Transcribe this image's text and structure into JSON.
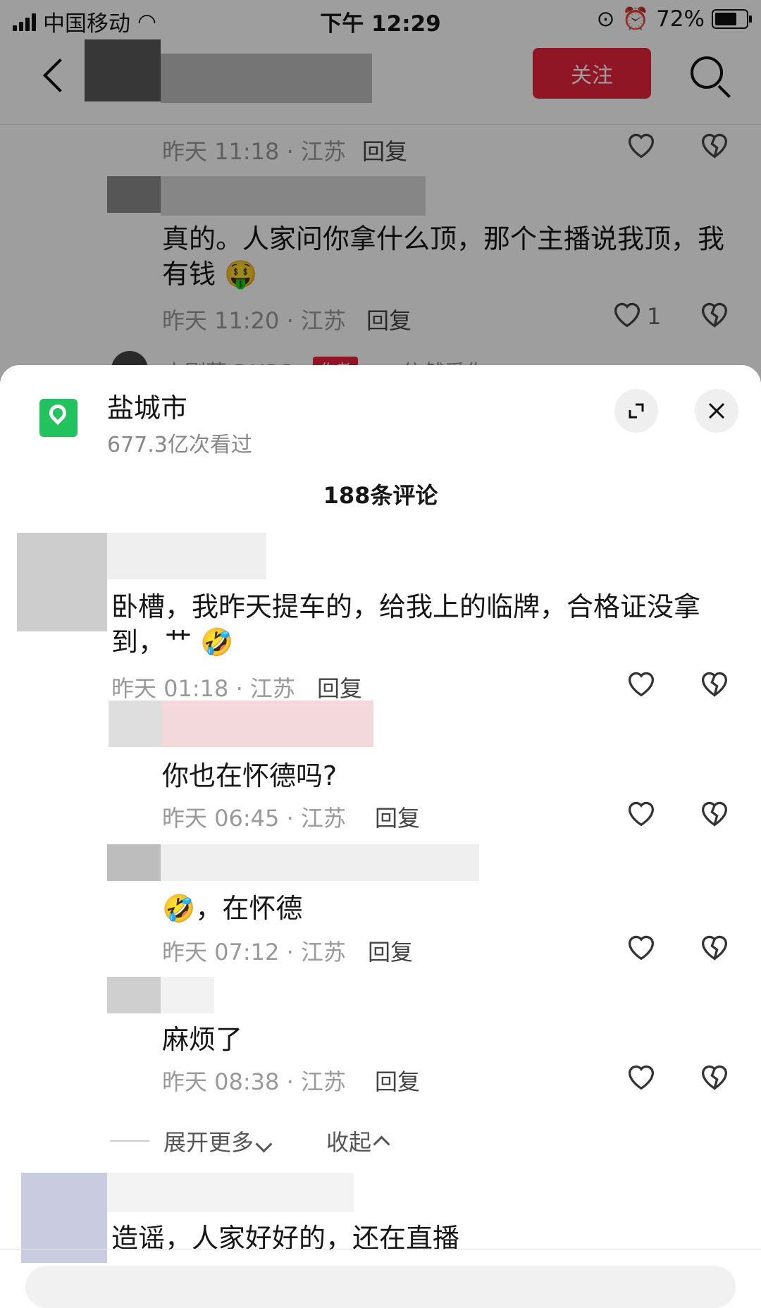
{
  "status": {
    "carrier": "中国移动",
    "time": "下午 12:29",
    "battery": "72%"
  },
  "header": {
    "follow_label": "关注"
  },
  "bg_comments": [
    {
      "meta": "昨天 11:18 · 江苏",
      "reply": "回复"
    },
    {
      "text": "真的。人家问你拿什么顶，那个主播说我顶，我有钱",
      "emoji": "🤑",
      "meta": "昨天 11:20 · 江苏",
      "reply": "回复",
      "likes": "1"
    }
  ],
  "bg_partial_author": "小刚菜 DUBS",
  "bg_partial_badge": "作者",
  "bg_partial_text": "> 依然爱你",
  "sheet": {
    "title": "盐城市",
    "views": "677.3亿次看过",
    "comment_count": "188条评论"
  },
  "comments": [
    {
      "text": "卧槽，我昨天提车的，给我上的临牌，合格证没拿到，艹",
      "emoji": "🤣",
      "meta": "昨天 01:18 · 江苏",
      "reply": "回复"
    },
    {
      "text": "你也在怀德吗?",
      "meta": "昨天 06:45 · 江苏",
      "reply": "回复"
    },
    {
      "text": "，在怀德",
      "emoji": "🤣",
      "meta": "昨天 07:12 · 江苏",
      "reply": "回复"
    },
    {
      "text": "麻烦了",
      "meta": "昨天 08:38 · 江苏",
      "reply": "回复"
    }
  ],
  "expand": {
    "more": "展开更多",
    "collapse": "收起"
  },
  "last_comment": {
    "text": "造谣，人家好好的，还在直播"
  },
  "colors": {
    "accent": "#e8243c",
    "location_green": "#22c35e"
  }
}
